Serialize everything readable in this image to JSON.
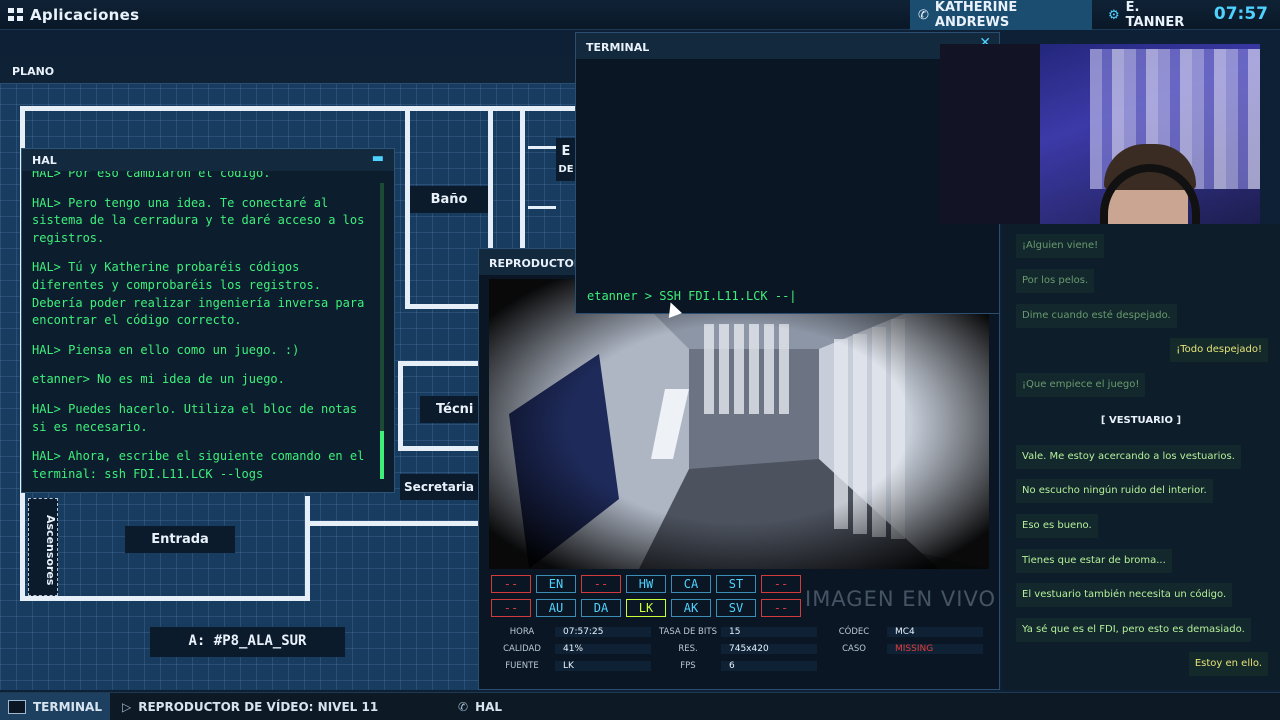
{
  "topbar": {
    "apps_label": "Aplicaciones",
    "contact_active": "KATHERINE ANDREWS",
    "contact_user": "E. TANNER",
    "clock": "07:57"
  },
  "plano": {
    "title": "PLANO",
    "rooms": {
      "bano": "Baño",
      "tecnico": "Técni",
      "secretaria": "Secretaria",
      "entrada": "Entrada",
      "ascensores": "Ascensores",
      "partial_e": "E",
      "partial_de": "DE"
    },
    "address": "A: #P8_ALA_SUR"
  },
  "hal": {
    "title": "HAL",
    "lines": [
      "HAL> Por eso cambiaron el código.",
      "HAL> Pero tengo una idea. Te conectaré al sistema de la cerradura y te daré acceso a los registros.",
      "HAL> Tú y Katherine probaréis códigos diferentes y comprobaréis los registros. Debería poder realizar ingeniería inversa para encontrar el código correcto.",
      "HAL> Piensa en ello como un juego. :)",
      "etanner> No es mi idea de un juego.",
      "HAL> Puedes hacerlo. Utiliza el bloc de notas si es necesario.",
      "HAL> Ahora, escribe el siguiente comando en el terminal: ssh FDI.L11.LCK --logs"
    ]
  },
  "terminal": {
    "title": "TERMINAL",
    "prompt": "etanner > SSH FDI.L11.LCK --|"
  },
  "video": {
    "title": "REPRODUCTOR D",
    "live_label": "IMAGEN EN VIVO",
    "chips_row1": [
      "--",
      "EN",
      "--",
      "HW",
      "CA",
      "ST",
      "--"
    ],
    "chips_row2": [
      "--",
      "AU",
      "DA",
      "LK",
      "AK",
      "SV",
      "--"
    ],
    "meta": {
      "hora_k": "HORA",
      "hora_v": "07:57:25",
      "calidad_k": "CALIDAD",
      "calidad_v": "41%",
      "fuente_k": "FUENTE",
      "fuente_v": "LK",
      "tasa_k": "TASA DE BITS",
      "tasa_v": "15",
      "res_k": "RES.",
      "res_v": "745x420",
      "fps_k": "FPS",
      "fps_v": "6",
      "codec_k": "CÓDEC",
      "codec_v": "MC4",
      "caso_k": "CASO",
      "caso_v": "MISSING"
    }
  },
  "chat": {
    "messages": [
      "¡Alguien viene!",
      "Por los pelos.",
      "Dime cuando esté despejado.",
      "¡Todo despejado!",
      "¡Que empiece el juego!",
      "Vale. Me estoy acercando a los vestuarios.",
      "No escucho ningún ruido del interior.",
      "Eso es bueno.",
      "Tienes que estar de broma...",
      "El vestuario también necesita un código.",
      "Ya sé que es el FDI, pero esto es demasiado.",
      "Estoy en ello."
    ],
    "separator": "[   VESTUARIO   ]"
  },
  "taskbar": {
    "terminal": "TERMINAL",
    "video": "REPRODUCTOR DE VÍDEO: NIVEL 11",
    "hal": "HAL"
  },
  "colors": {
    "terminal_green": "#3ef07a",
    "accent_cyan": "#4fd2ff",
    "alert_red": "#d23b3b"
  },
  "icons": [
    "apps-grid-icon",
    "phone-icon",
    "user-gear-icon",
    "terminal-icon",
    "video-file-icon",
    "phone-icon",
    "close-icon",
    "minimize-icon"
  ]
}
